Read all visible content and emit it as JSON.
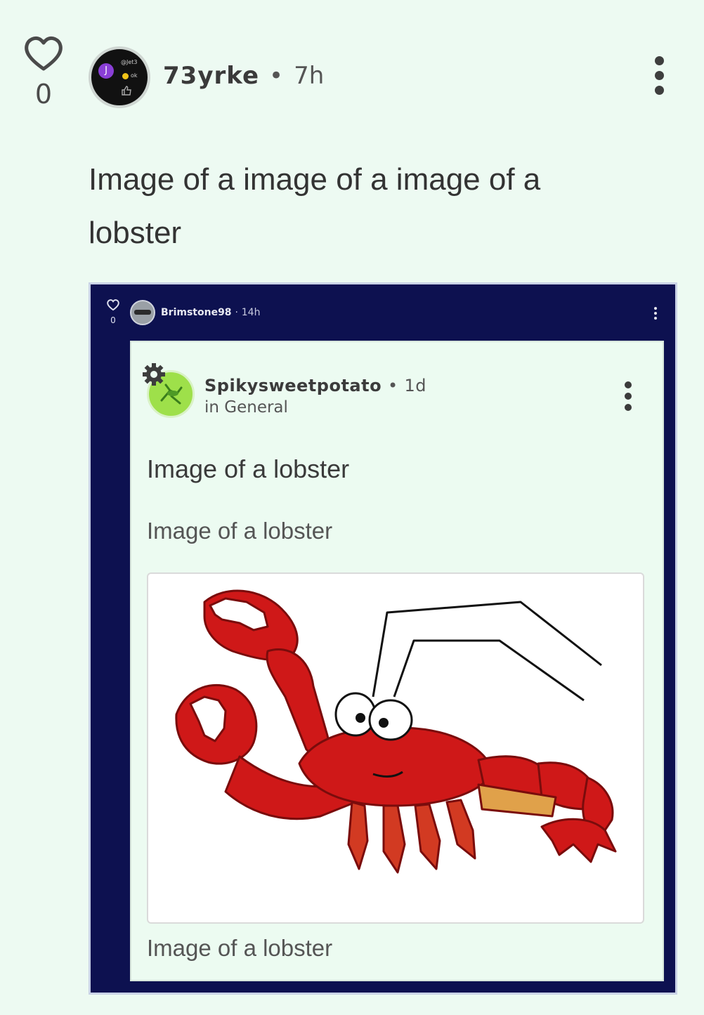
{
  "post": {
    "like_count": "0",
    "username": "73yrke",
    "separator": "•",
    "time": "7h",
    "title": "Image of a image of a image of a lobster"
  },
  "embed1": {
    "like_count": "0",
    "username": "Brimstone98",
    "separator": "·",
    "time": "14h"
  },
  "embed2": {
    "username": "Spikysweetpotato",
    "separator": "•",
    "time": "1d",
    "category": "in General",
    "title": "Image of a lobster",
    "subtitle": "Image of a lobster",
    "caption": "Image of a lobster"
  },
  "avatar_badge": {
    "letter": "J",
    "handle": "@Jet3",
    "ok": "ok"
  },
  "colors": {
    "background": "#edfaf2",
    "embed_frame": "#0d1150",
    "lobster_red": "#d11a1a"
  },
  "icons": [
    "heart-icon",
    "kebab-menu-icon",
    "gear-icon"
  ]
}
